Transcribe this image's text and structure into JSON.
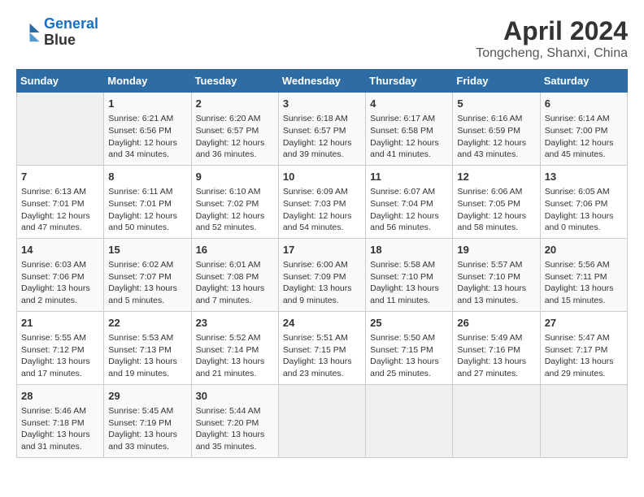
{
  "logo": {
    "line1": "General",
    "line2": "Blue"
  },
  "title": "April 2024",
  "subtitle": "Tongcheng, Shanxi, China",
  "headers": [
    "Sunday",
    "Monday",
    "Tuesday",
    "Wednesday",
    "Thursday",
    "Friday",
    "Saturday"
  ],
  "weeks": [
    [
      {
        "day": "",
        "info": ""
      },
      {
        "day": "1",
        "info": "Sunrise: 6:21 AM\nSunset: 6:56 PM\nDaylight: 12 hours\nand 34 minutes."
      },
      {
        "day": "2",
        "info": "Sunrise: 6:20 AM\nSunset: 6:57 PM\nDaylight: 12 hours\nand 36 minutes."
      },
      {
        "day": "3",
        "info": "Sunrise: 6:18 AM\nSunset: 6:57 PM\nDaylight: 12 hours\nand 39 minutes."
      },
      {
        "day": "4",
        "info": "Sunrise: 6:17 AM\nSunset: 6:58 PM\nDaylight: 12 hours\nand 41 minutes."
      },
      {
        "day": "5",
        "info": "Sunrise: 6:16 AM\nSunset: 6:59 PM\nDaylight: 12 hours\nand 43 minutes."
      },
      {
        "day": "6",
        "info": "Sunrise: 6:14 AM\nSunset: 7:00 PM\nDaylight: 12 hours\nand 45 minutes."
      }
    ],
    [
      {
        "day": "7",
        "info": "Sunrise: 6:13 AM\nSunset: 7:01 PM\nDaylight: 12 hours\nand 47 minutes."
      },
      {
        "day": "8",
        "info": "Sunrise: 6:11 AM\nSunset: 7:01 PM\nDaylight: 12 hours\nand 50 minutes."
      },
      {
        "day": "9",
        "info": "Sunrise: 6:10 AM\nSunset: 7:02 PM\nDaylight: 12 hours\nand 52 minutes."
      },
      {
        "day": "10",
        "info": "Sunrise: 6:09 AM\nSunset: 7:03 PM\nDaylight: 12 hours\nand 54 minutes."
      },
      {
        "day": "11",
        "info": "Sunrise: 6:07 AM\nSunset: 7:04 PM\nDaylight: 12 hours\nand 56 minutes."
      },
      {
        "day": "12",
        "info": "Sunrise: 6:06 AM\nSunset: 7:05 PM\nDaylight: 12 hours\nand 58 minutes."
      },
      {
        "day": "13",
        "info": "Sunrise: 6:05 AM\nSunset: 7:06 PM\nDaylight: 13 hours\nand 0 minutes."
      }
    ],
    [
      {
        "day": "14",
        "info": "Sunrise: 6:03 AM\nSunset: 7:06 PM\nDaylight: 13 hours\nand 2 minutes."
      },
      {
        "day": "15",
        "info": "Sunrise: 6:02 AM\nSunset: 7:07 PM\nDaylight: 13 hours\nand 5 minutes."
      },
      {
        "day": "16",
        "info": "Sunrise: 6:01 AM\nSunset: 7:08 PM\nDaylight: 13 hours\nand 7 minutes."
      },
      {
        "day": "17",
        "info": "Sunrise: 6:00 AM\nSunset: 7:09 PM\nDaylight: 13 hours\nand 9 minutes."
      },
      {
        "day": "18",
        "info": "Sunrise: 5:58 AM\nSunset: 7:10 PM\nDaylight: 13 hours\nand 11 minutes."
      },
      {
        "day": "19",
        "info": "Sunrise: 5:57 AM\nSunset: 7:10 PM\nDaylight: 13 hours\nand 13 minutes."
      },
      {
        "day": "20",
        "info": "Sunrise: 5:56 AM\nSunset: 7:11 PM\nDaylight: 13 hours\nand 15 minutes."
      }
    ],
    [
      {
        "day": "21",
        "info": "Sunrise: 5:55 AM\nSunset: 7:12 PM\nDaylight: 13 hours\nand 17 minutes."
      },
      {
        "day": "22",
        "info": "Sunrise: 5:53 AM\nSunset: 7:13 PM\nDaylight: 13 hours\nand 19 minutes."
      },
      {
        "day": "23",
        "info": "Sunrise: 5:52 AM\nSunset: 7:14 PM\nDaylight: 13 hours\nand 21 minutes."
      },
      {
        "day": "24",
        "info": "Sunrise: 5:51 AM\nSunset: 7:15 PM\nDaylight: 13 hours\nand 23 minutes."
      },
      {
        "day": "25",
        "info": "Sunrise: 5:50 AM\nSunset: 7:15 PM\nDaylight: 13 hours\nand 25 minutes."
      },
      {
        "day": "26",
        "info": "Sunrise: 5:49 AM\nSunset: 7:16 PM\nDaylight: 13 hours\nand 27 minutes."
      },
      {
        "day": "27",
        "info": "Sunrise: 5:47 AM\nSunset: 7:17 PM\nDaylight: 13 hours\nand 29 minutes."
      }
    ],
    [
      {
        "day": "28",
        "info": "Sunrise: 5:46 AM\nSunset: 7:18 PM\nDaylight: 13 hours\nand 31 minutes."
      },
      {
        "day": "29",
        "info": "Sunrise: 5:45 AM\nSunset: 7:19 PM\nDaylight: 13 hours\nand 33 minutes."
      },
      {
        "day": "30",
        "info": "Sunrise: 5:44 AM\nSunset: 7:20 PM\nDaylight: 13 hours\nand 35 minutes."
      },
      {
        "day": "",
        "info": ""
      },
      {
        "day": "",
        "info": ""
      },
      {
        "day": "",
        "info": ""
      },
      {
        "day": "",
        "info": ""
      }
    ]
  ]
}
